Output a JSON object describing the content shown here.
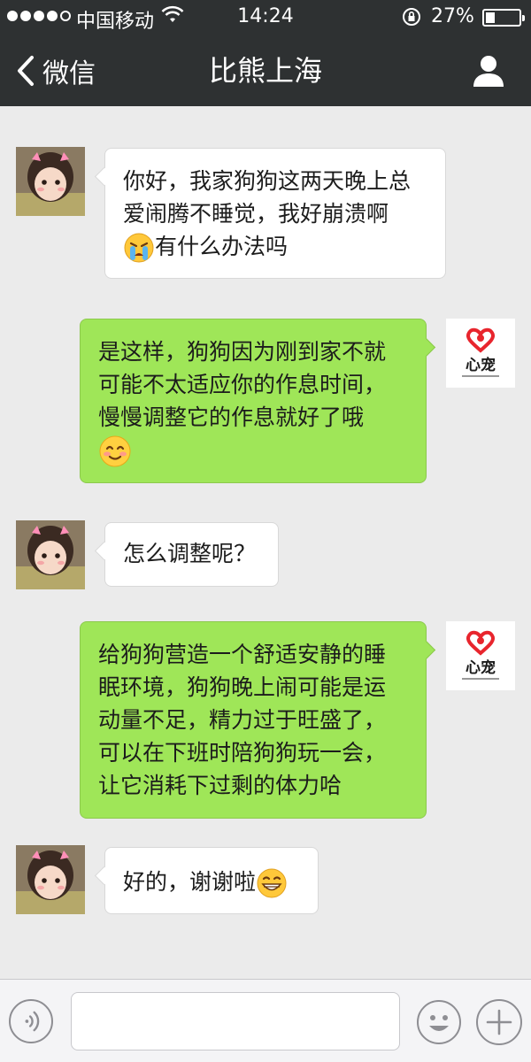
{
  "status_bar": {
    "carrier": "中国移动",
    "time": "14:24",
    "battery": "27%",
    "battery_level": 0.27,
    "signal_bars_filled": 4,
    "signal_bars_total": 5
  },
  "nav": {
    "back_label": "微信",
    "title": "比熊上海",
    "profile_icon": "person-icon"
  },
  "shop_logo_text": "心宠",
  "messages": [
    {
      "side": "left",
      "lines": [
        "你好，我家狗狗这两天晚上总",
        "爱闹腾不睡觉，我好崩溃啊"
      ],
      "emoji": "crying-face-icon",
      "after_emoji": "有什么办法吗"
    },
    {
      "side": "right",
      "lines": [
        "是这样，狗狗因为刚到家不就",
        "可能不太适应你的作息时间，",
        "慢慢调整它的作息就好了哦"
      ],
      "emoji": "smiling-face-icon"
    },
    {
      "side": "left",
      "lines": [
        "怎么调整呢？"
      ]
    },
    {
      "side": "right",
      "lines": [
        "给狗狗营造一个舒适安静的睡",
        "眠环境，狗狗晚上闹可能是运",
        "动量不足，精力过于旺盛了，",
        "可以在下班时陪狗狗玩一会，",
        "让它消耗下过剩的体力哈"
      ]
    },
    {
      "side": "left",
      "lines": [
        "好的，谢谢啦"
      ],
      "emoji": "grinning-face-icon"
    }
  ],
  "input": {
    "value": "",
    "placeholder": ""
  },
  "colors": {
    "header_bg": "#2e3132",
    "chat_bg": "#ebebeb",
    "bubble_sent": "#9fe658",
    "bubble_received": "#ffffff",
    "logo_red": "#e8252d"
  }
}
